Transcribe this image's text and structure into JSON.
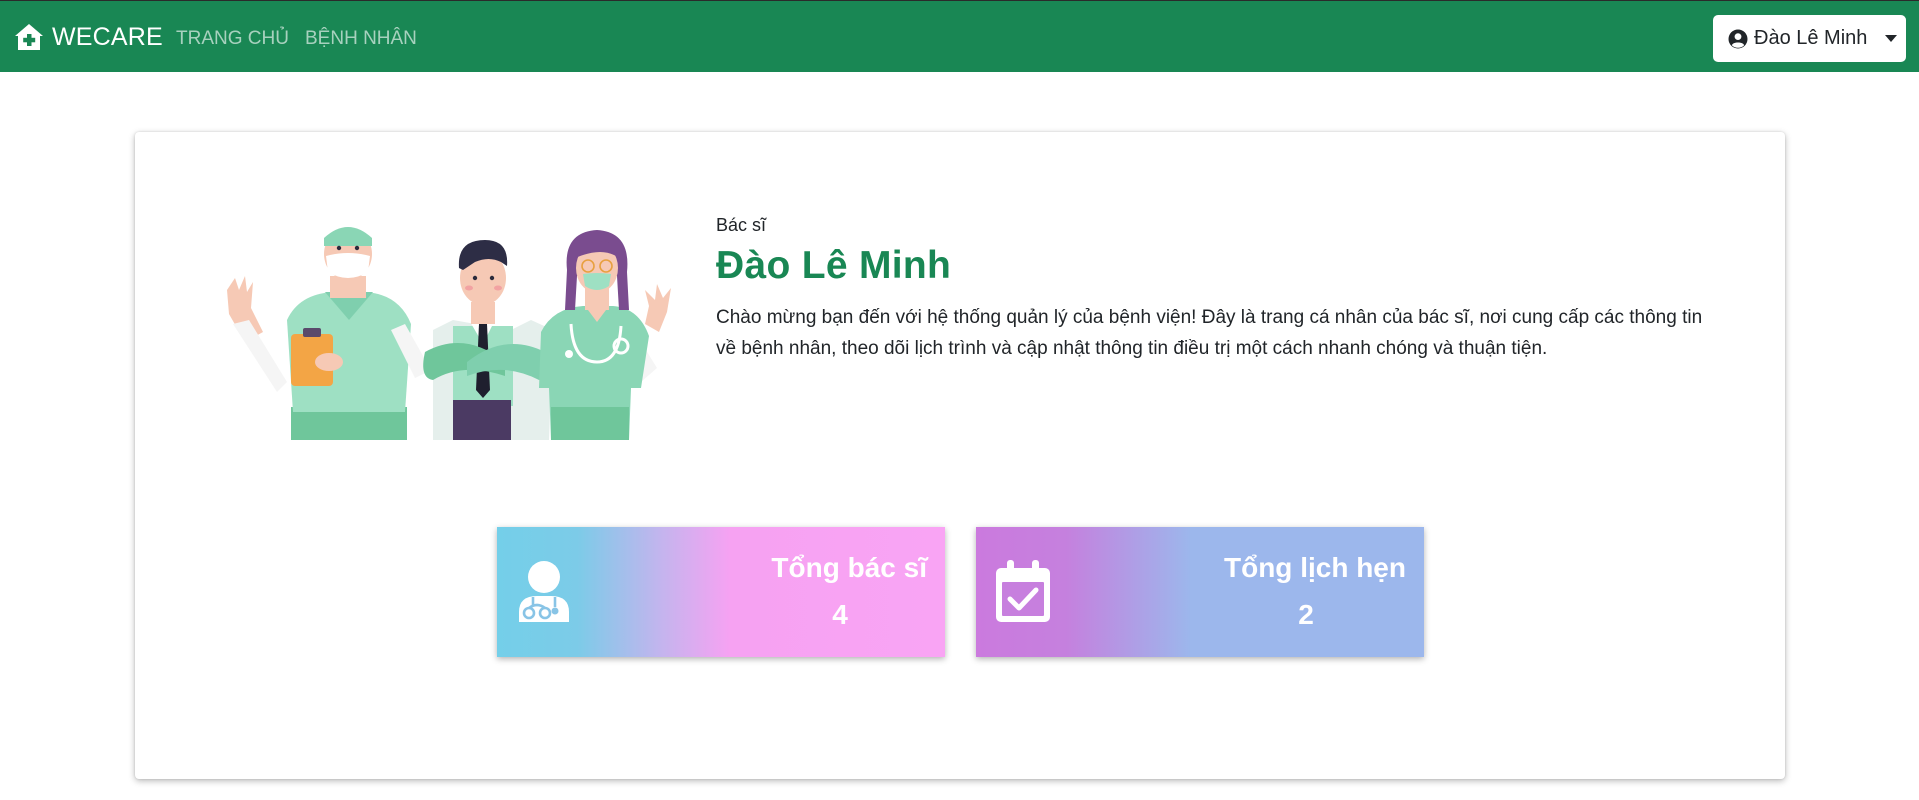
{
  "navbar": {
    "brand": "WECARE",
    "brand_icon": "house-medical-icon",
    "links": [
      "TRANG CHỦ",
      "BỆNH NHÂN"
    ],
    "user_menu": {
      "name": "Đào Lê Minh",
      "icon": "user-circle-icon",
      "caret": "caret-down-icon"
    }
  },
  "profile": {
    "role": "Bác sĩ",
    "name": "Đào Lê Minh",
    "welcome": "Chào mừng bạn đến với hệ thống quản lý của bệnh viện! Đây là trang cá nhân của bác sĩ, nơi cung cấp các thông tin về bệnh nhân, theo dõi lịch trình và cập nhật thông tin điều trị một cách nhanh chóng và thuận tiện."
  },
  "stats": [
    {
      "title": "Tổng bác sĩ",
      "value": "4",
      "icon": "user-doctor-icon"
    },
    {
      "title": "Tổng lịch hẹn",
      "value": "2",
      "icon": "calendar-check-icon"
    }
  ],
  "colors": {
    "primary": "#198754",
    "doctors_gradient": [
      "#74cfe9",
      "#f9a4f4"
    ],
    "appointments_gradient": [
      "#cb7ade",
      "#9cb7ec"
    ]
  }
}
